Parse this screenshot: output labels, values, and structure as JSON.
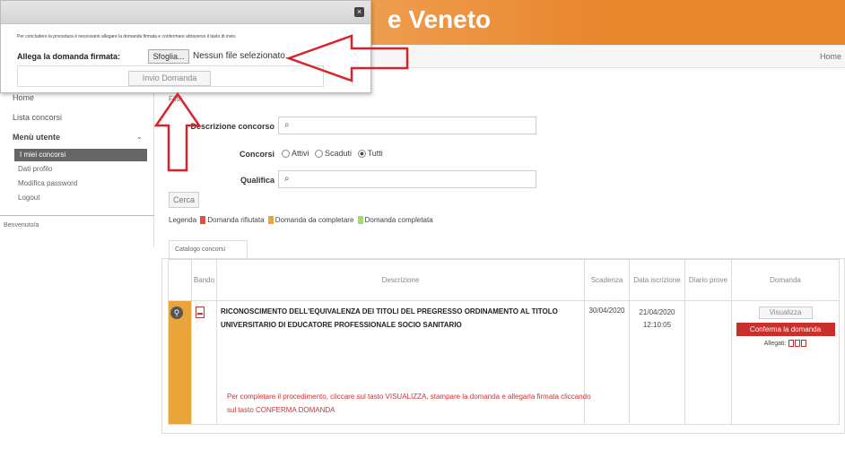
{
  "header": {
    "title": "e Veneto",
    "home_link": "Home"
  },
  "sidebar": {
    "items": [
      "Home",
      "Lista concorsi",
      "Menù utente"
    ],
    "submenu": [
      "I miei concorsi",
      "Dati profilo",
      "Modifica password",
      "Logout"
    ],
    "active_index": 0,
    "welcome": "Benvenuto/a"
  },
  "filters": {
    "section_label": "Filtri",
    "descrizione_label": "Descrizione concorso",
    "concorsi_label": "Concorsi",
    "concorsi_options": [
      "Attivi",
      "Scaduti",
      "Tutti"
    ],
    "concorsi_selected": "Tutti",
    "qualifica_label": "Qualifica",
    "search_button": "Cerca"
  },
  "legend": {
    "label": "Legenda",
    "items": [
      {
        "label": "Domanda rifiutata",
        "color": "#e74c3c"
      },
      {
        "label": "Domanda da completare",
        "color": "#e9a53a"
      },
      {
        "label": "Domanda completata",
        "color": "#a6d96a"
      }
    ]
  },
  "catalog": {
    "tab_label": "Catalogo concorsi",
    "columns": [
      "Bando",
      "Descrizione",
      "Scadenza",
      "Data iscrizione",
      "Diario prove",
      "Domanda"
    ],
    "rows": [
      {
        "descrizione": "RICONOSCIMENTO DELL'EQUIVALENZA DEI TITOLI DEL PREGRESSO ORDINAMENTO AL TITOLO UNIVERSITARIO DI EDUCATORE PROFESSIONALE SOCIO SANITARIO",
        "scadenza": "30/04/2020",
        "data_iscrizione": "21/04/2020 12:10:05",
        "diario_prove": "",
        "visualizza_button": "Visualizza",
        "conferma_button": "Conferma la domanda",
        "allegati_label": "Allegati:",
        "note": "Per completare il procedimento, cliccare sul tasto VISUALIZZA, stampare la domanda e allegarla firmata cliccando sul tasto CONFERMA DOMANDA"
      }
    ],
    "status_color": "#e9a53a",
    "confirm_color": "#c9302c"
  },
  "dialog": {
    "close_glyph": "×",
    "note": "Per concludere la procedura è necessario allegare la domanda firmata e confermare attraverso il tasto di invio.",
    "file_label": "Allega la domanda firmata:",
    "browse_button": "Sfoglia...",
    "file_status": "Nessun file selezionato.",
    "send_button": "Invio Domanda"
  },
  "annotation": {
    "arrow_color": "#d9222a"
  }
}
